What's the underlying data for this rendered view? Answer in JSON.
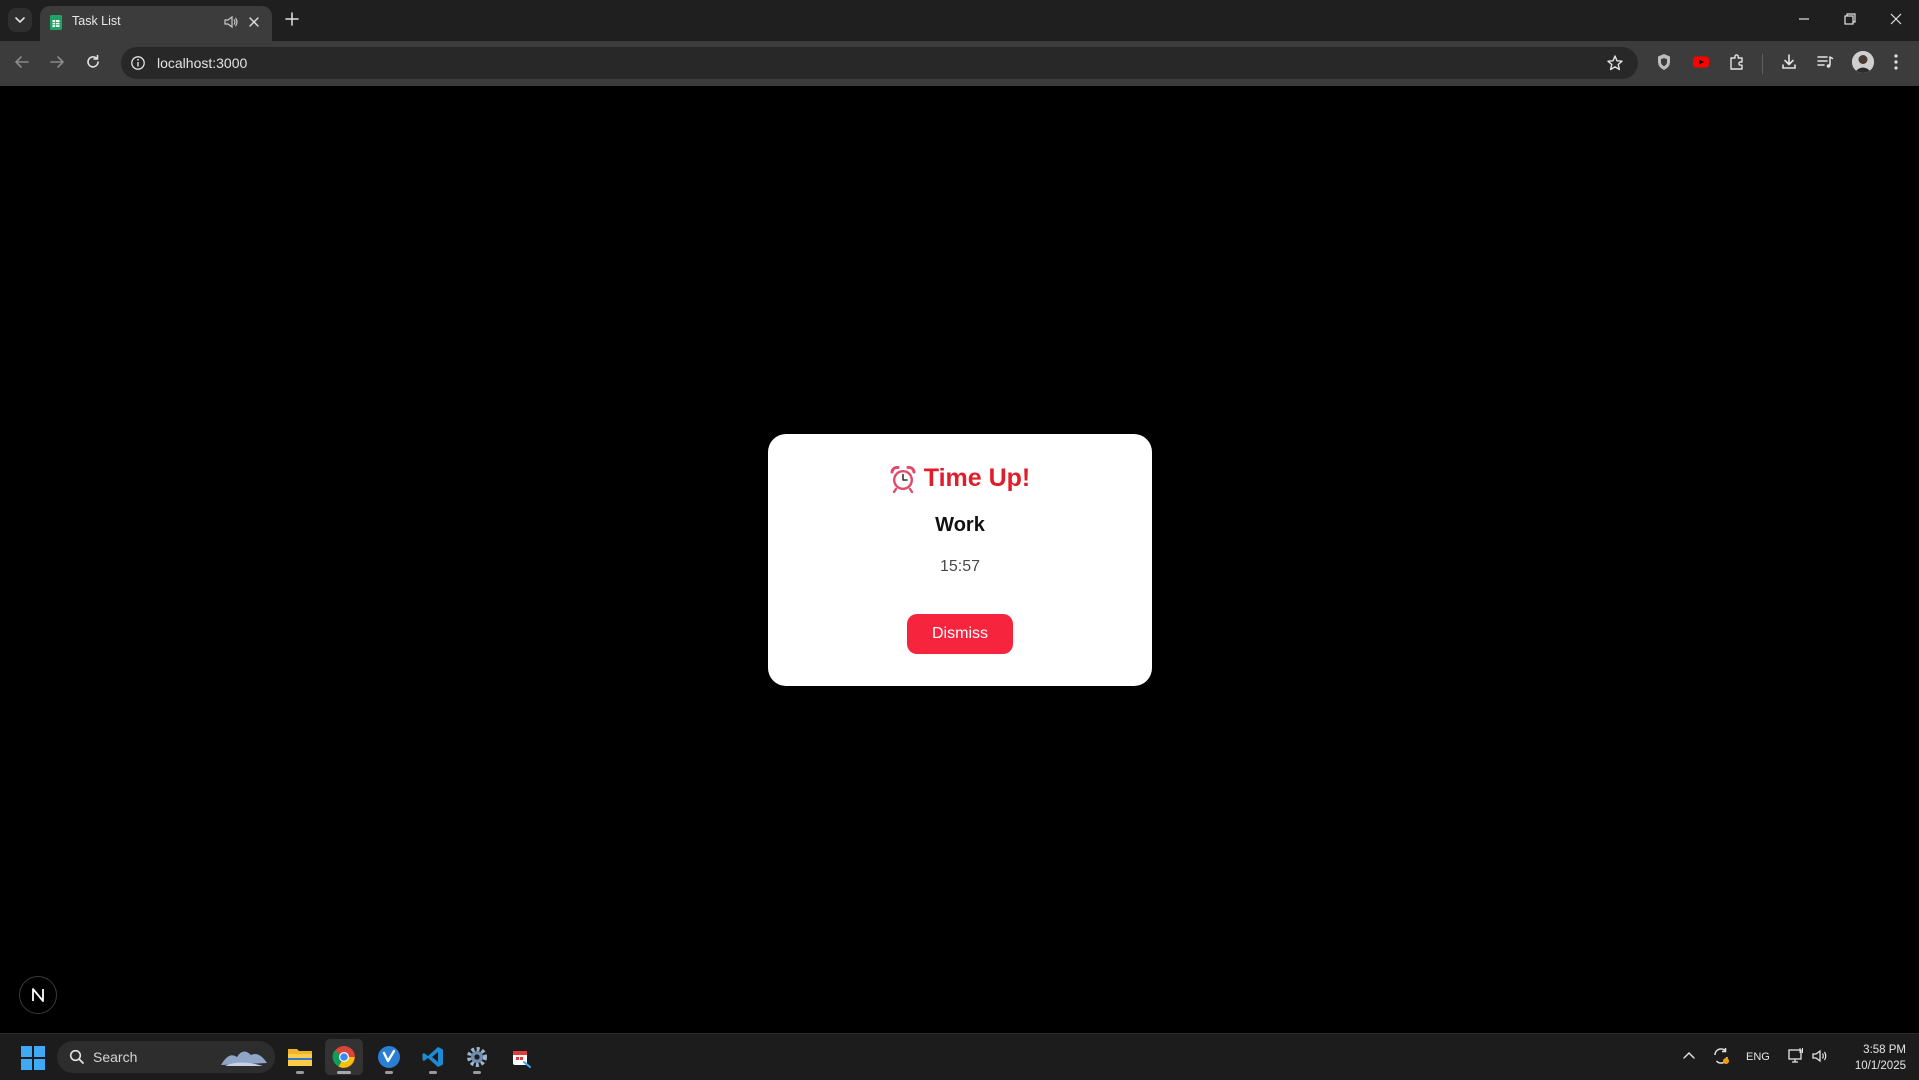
{
  "browser": {
    "tab_title": "Task List",
    "url": "localhost:3000"
  },
  "modal": {
    "icon": "alarm-clock-icon",
    "title": "Time Up!",
    "task_name": "Work",
    "time": "15:57",
    "dismiss_label": "Dismiss"
  },
  "dev_badge": {
    "label": "N"
  },
  "taskbar": {
    "search_label": "Search",
    "language": "ENG",
    "time": "3:58 PM",
    "date": "10/1/2025"
  },
  "colors": {
    "title_red": "#e11d2a",
    "button_red": "#f7243d",
    "page_bg": "#000000",
    "modal_bg": "#ffffff"
  }
}
